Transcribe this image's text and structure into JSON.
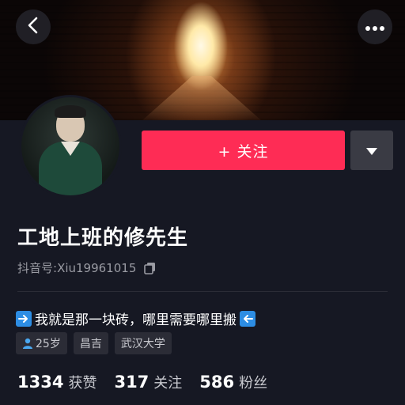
{
  "header": {
    "back_icon": "chevron-left-icon",
    "more_icon": "more-dots-icon"
  },
  "profile": {
    "nickname": "工地上班的修先生",
    "id_label": "抖音号:",
    "id_value": "Xiu19961015",
    "follow_label": "+ 关注",
    "accent_color": "#fe2c55"
  },
  "bio": {
    "text": "我就是那一块砖，哪里需要哪里搬",
    "icon_left": "right-arrow-icon",
    "icon_right": "left-arrow-icon"
  },
  "tags": [
    {
      "label": "25岁",
      "icon": "person-icon"
    },
    {
      "label": "昌吉"
    },
    {
      "label": "武汉大学"
    }
  ],
  "stats": [
    {
      "value": "1334",
      "label": "获赞"
    },
    {
      "value": "317",
      "label": "关注"
    },
    {
      "value": "586",
      "label": "粉丝"
    }
  ]
}
